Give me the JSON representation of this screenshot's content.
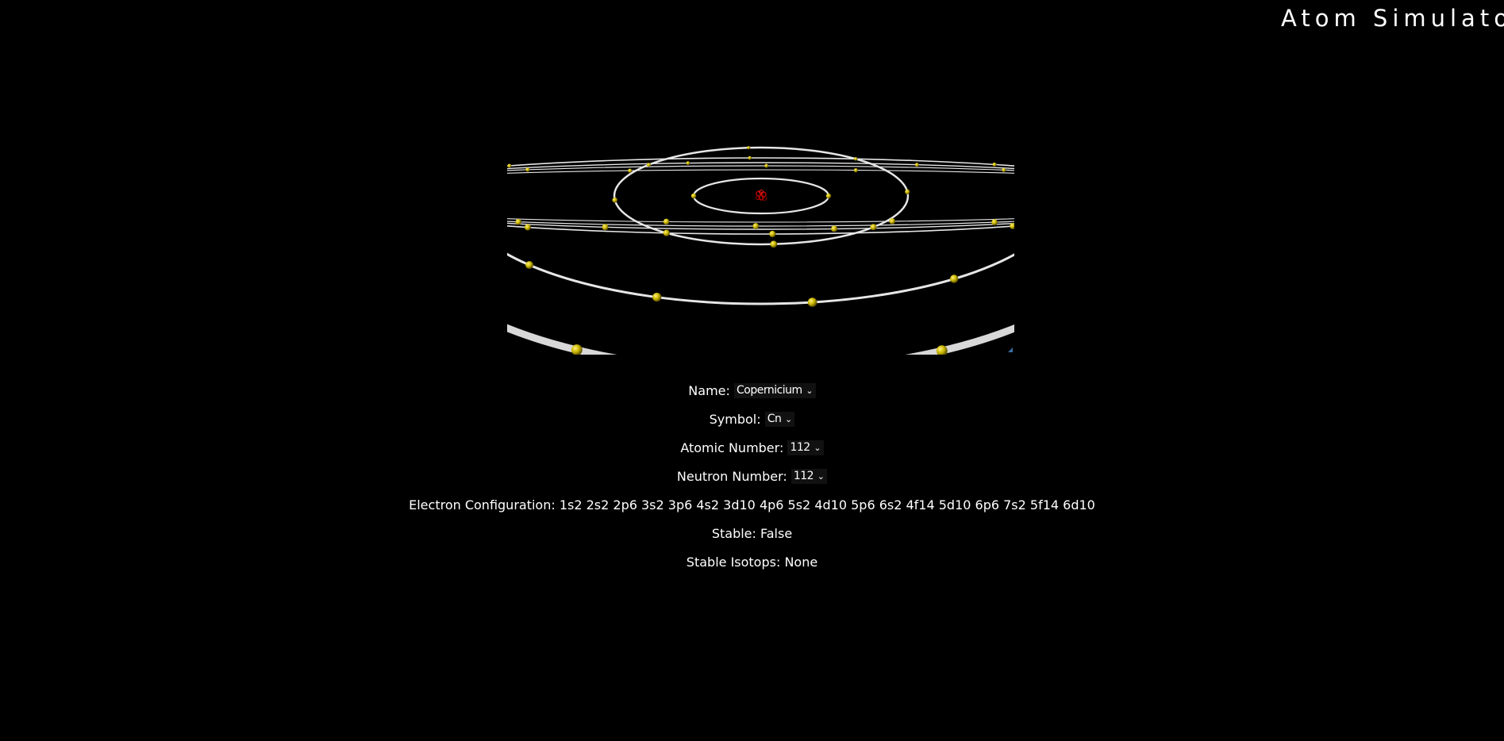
{
  "header": {
    "title": "Atom Simulato"
  },
  "element": {
    "name_label": "Name:",
    "name_value": "Copernicium",
    "symbol_label": "Symbol:",
    "symbol_value": "Cn",
    "atomic_number_label": "Atomic Number:",
    "atomic_number_value": "112",
    "neutron_number_label": "Neutron Number:",
    "neutron_number_value": "112",
    "electron_configuration_label": "Electron Configuration:",
    "electron_configuration_value": "1s2 2s2 2p6 3s2 3p6 4s2 3d10 4p6 5s2 4d10 5p6 6s2 4f14 5d10 6p6 7s2 5f14 6d10",
    "stable_label": "Stable:",
    "stable_value": "False",
    "stable_isotopes_label": "Stable Isotops:",
    "stable_isotopes_value": "None"
  },
  "colors": {
    "background": "#000000",
    "text": "#ffffff",
    "orbit": "#e6e6e6",
    "electron": "#c8b400",
    "nucleus": "#cc0000",
    "resize_handle": "#3a6ea5"
  },
  "icons": {
    "dropdown": "chevron-down-icon"
  }
}
